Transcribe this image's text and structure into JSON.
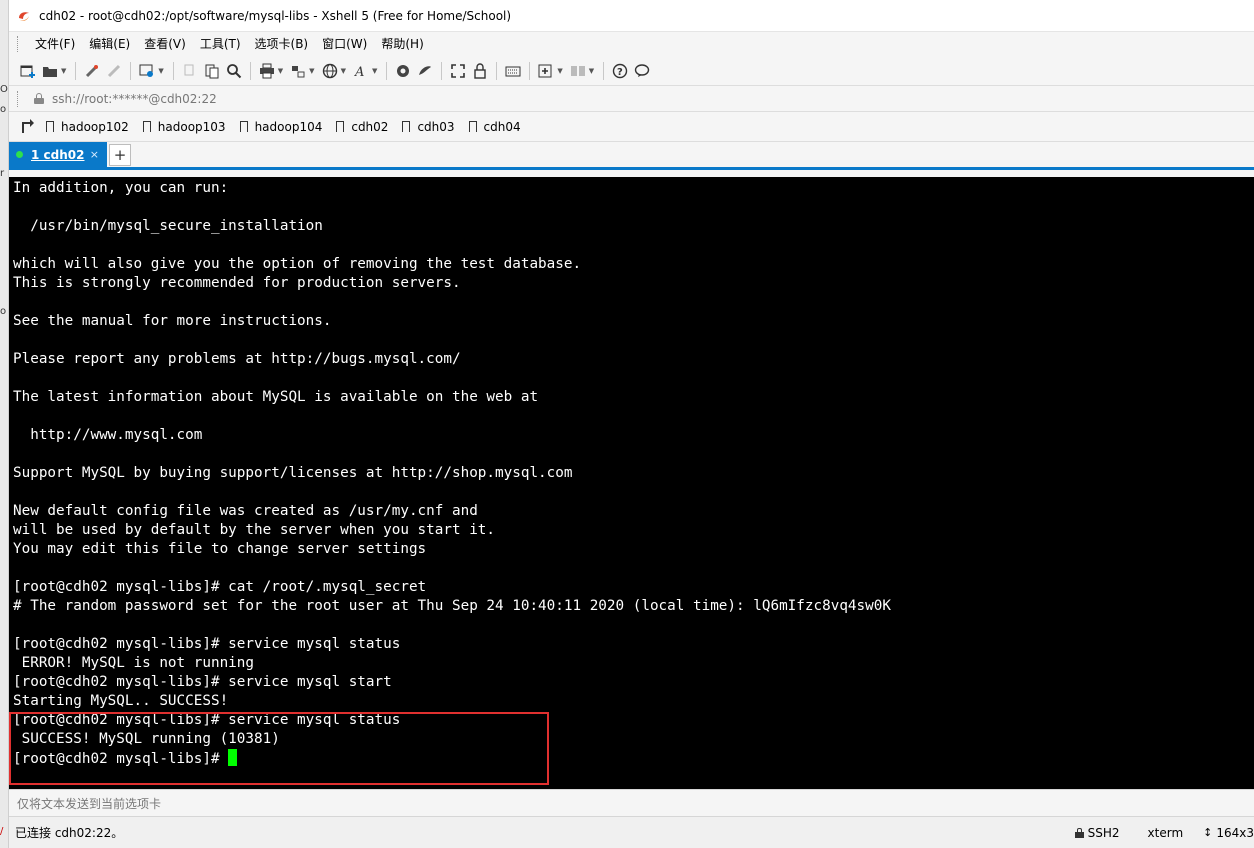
{
  "window": {
    "title": "cdh02 - root@cdh02:/opt/software/mysql-libs - Xshell 5 (Free for Home/School)",
    "accent": "#0a79c9"
  },
  "menu": [
    "文件(F)",
    "编辑(E)",
    "查看(V)",
    "工具(T)",
    "选项卡(B)",
    "窗口(W)",
    "帮助(H)"
  ],
  "address": {
    "value": "ssh://root:******@cdh02:22"
  },
  "favorites": [
    "hadoop102",
    "hadoop103",
    "hadoop104",
    "cdh02",
    "cdh03",
    "cdh04"
  ],
  "tabs": [
    {
      "label": "1 cdh02",
      "close": "×",
      "status": "connected"
    }
  ],
  "tab_add": "+",
  "terminal": {
    "background": "#000000",
    "foreground": "#ffffff",
    "cursor_color": "#00ff00",
    "lines": [
      "In addition, you can run:",
      "",
      "  /usr/bin/mysql_secure_installation",
      "",
      "which will also give you the option of removing the test database.",
      "This is strongly recommended for production servers.",
      "",
      "See the manual for more instructions.",
      "",
      "Please report any problems at http://bugs.mysql.com/",
      "",
      "The latest information about MySQL is available on the web at",
      "",
      "  http://www.mysql.com",
      "",
      "Support MySQL by buying support/licenses at http://shop.mysql.com",
      "",
      "New default config file was created as /usr/my.cnf and",
      "will be used by default by the server when you start it.",
      "You may edit this file to change server settings",
      "",
      "[root@cdh02 mysql-libs]# cat /root/.mysql_secret",
      "# The random password set for the root user at Thu Sep 24 10:40:11 2020 (local time): lQ6mIfzc8vq4sw0K",
      "",
      "[root@cdh02 mysql-libs]# service mysql status",
      " ERROR! MySQL is not running",
      "[root@cdh02 mysql-libs]# service mysql start",
      "Starting MySQL.. SUCCESS!",
      "[root@cdh02 mysql-libs]# service mysql status",
      " SUCCESS! MySQL running (10381)",
      "[root@cdh02 mysql-libs]# "
    ],
    "highlight_color": "#e0302f"
  },
  "sendbar": {
    "placeholder": "仅将文本发送到当前选项卡"
  },
  "status": {
    "connection": "已连接 cdh02:22。",
    "protocol": "SSH2",
    "term": "xterm",
    "size": "164x3"
  }
}
